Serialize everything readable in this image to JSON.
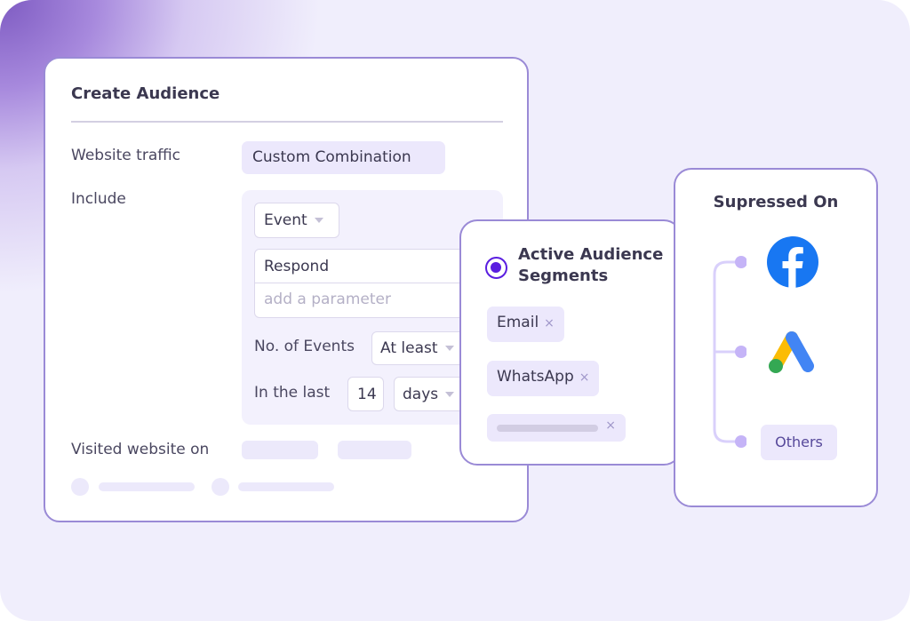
{
  "create_audience": {
    "title": "Create Audience",
    "website_traffic_label": "Website traffic",
    "website_traffic_value": "Custom Combination",
    "include_label": "Include",
    "event_select_value": "Event",
    "event_name_value": "Respond",
    "parameter_placeholder": "add a parameter",
    "no_of_events_label": "No. of Events",
    "no_of_events_value": "At least",
    "in_the_last_label": "In the last",
    "in_the_last_number": "14",
    "in_the_last_unit": "days",
    "visited_website_label": "Visited website on"
  },
  "active_segments": {
    "title": "Active Audience Segments",
    "tags": [
      {
        "label": "Email",
        "remove": "×"
      },
      {
        "label": "WhatsApp",
        "remove": "×"
      },
      {
        "label": "",
        "remove": "×"
      }
    ]
  },
  "suppressed": {
    "title": "Supressed On",
    "channels": [
      {
        "name": "Facebook",
        "icon": "facebook-icon"
      },
      {
        "name": "Google Ads",
        "icon": "google-ads-icon"
      },
      {
        "name": "Others",
        "label": "Others"
      }
    ]
  },
  "colors": {
    "accent": "#5a1ee0",
    "card_border": "#9a8ad6",
    "chip_bg": "#ece8fc",
    "facebook": "#1877f2"
  }
}
